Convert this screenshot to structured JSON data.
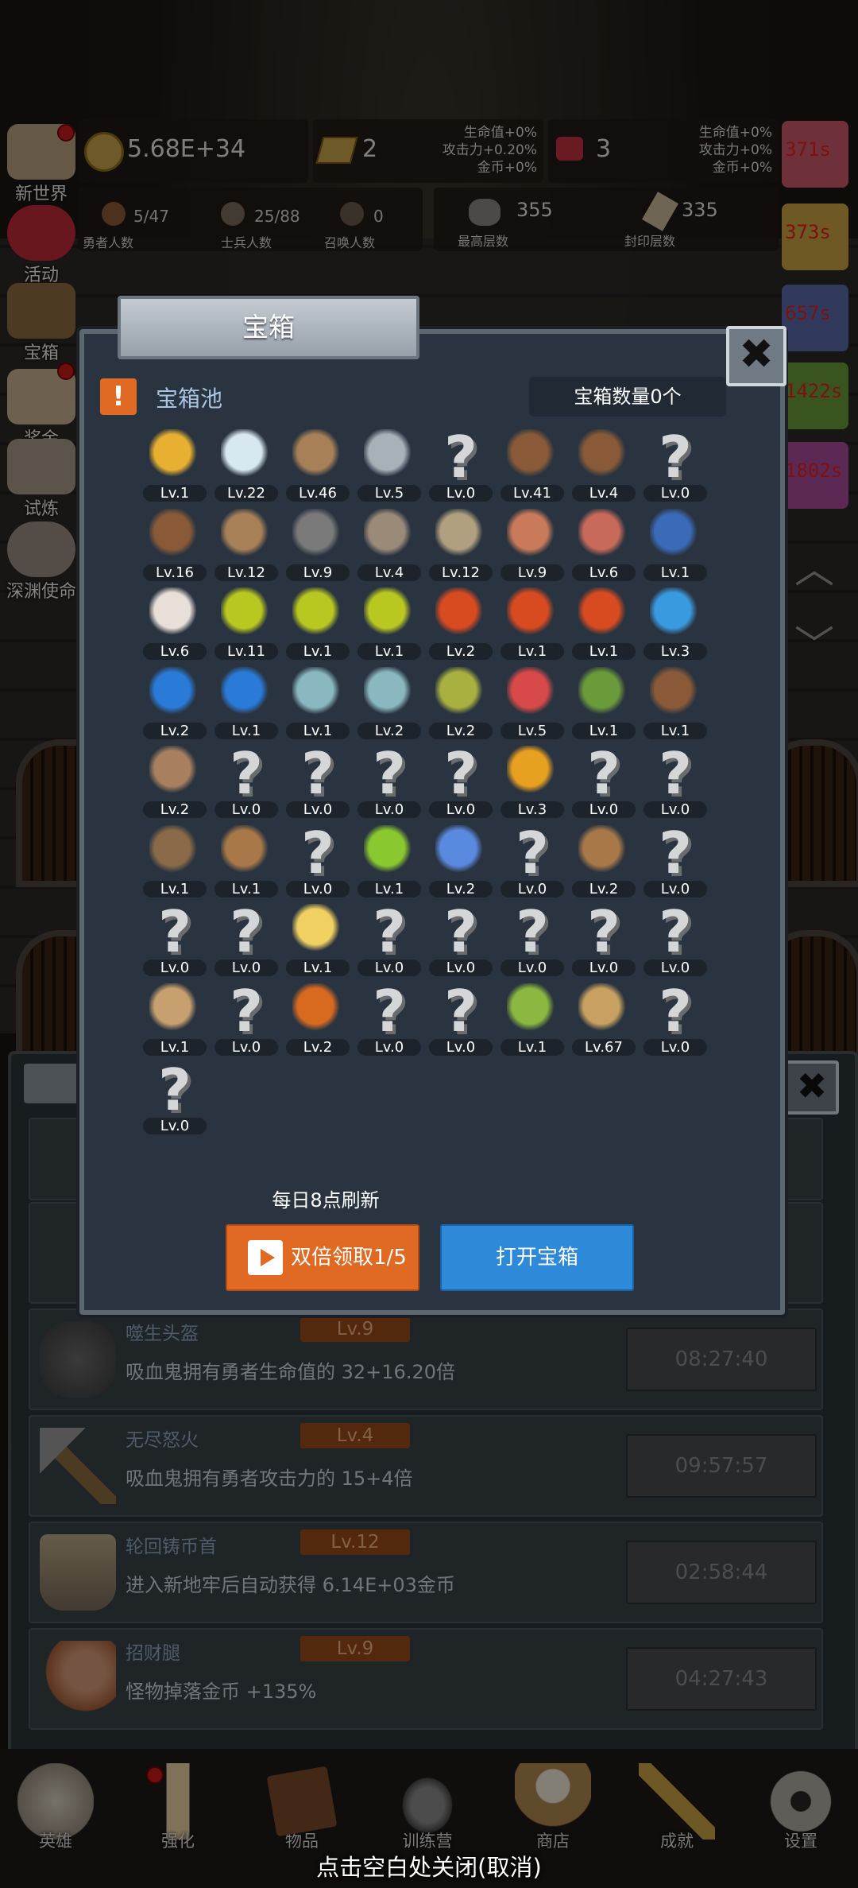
{
  "resources": {
    "gold": "5.68E+34",
    "gold_bar": "2",
    "gold_bar_stats": [
      "生命值+0%",
      "攻击力+0.20%",
      "金币+0%"
    ],
    "gem": "3",
    "gem_stats": [
      "生命值+0%",
      "攻击力+0%",
      "金币+0%"
    ],
    "heroes": "5/47",
    "heroes_label": "勇者人数",
    "soldiers": "25/88",
    "soldiers_label": "士兵人数",
    "summons": "0",
    "summons_label": "召唤人数",
    "max_floor": "355",
    "max_floor_label": "最高层数",
    "seal_floor": "335",
    "seal_floor_label": "封印层数"
  },
  "side_menu": [
    "新世界",
    "活动",
    "宝箱",
    "奖金",
    "试炼",
    "深渊使命"
  ],
  "side_timers": [
    "371s",
    "373s",
    "657s",
    "1422s",
    "1802s"
  ],
  "modal": {
    "title": "宝箱",
    "pool_label": "宝箱池",
    "count_label": "宝箱数量0个",
    "close": "✖",
    "refresh_text": "每日8点刷新",
    "double_button": "双倍领取1/5",
    "open_button": "打开宝箱"
  },
  "items": [
    {
      "icon": "crown-icon",
      "level": "Lv.1"
    },
    {
      "icon": "diamond-icon",
      "level": "Lv.22"
    },
    {
      "icon": "wooden-sword-icon",
      "level": "Lv.46"
    },
    {
      "icon": "steel-sword-icon",
      "level": "Lv.5"
    },
    {
      "icon": "unknown-icon",
      "level": "Lv.0"
    },
    {
      "icon": "leather-armor-icon",
      "level": "Lv.41"
    },
    {
      "icon": "backpack-icon",
      "level": "Lv.4"
    },
    {
      "icon": "unknown-icon",
      "level": "Lv.0"
    },
    {
      "icon": "leather-helmet-icon",
      "level": "Lv.16"
    },
    {
      "icon": "dagger-icon",
      "level": "Lv.12"
    },
    {
      "icon": "knight-helmet-icon",
      "level": "Lv.9"
    },
    {
      "icon": "hammer-icon",
      "level": "Lv.4"
    },
    {
      "icon": "great-helm-icon",
      "level": "Lv.12"
    },
    {
      "icon": "meat-icon",
      "level": "Lv.9"
    },
    {
      "icon": "steak-icon",
      "level": "Lv.6"
    },
    {
      "icon": "blue-sack-icon",
      "level": "Lv.1"
    },
    {
      "icon": "flour-bowl-icon",
      "level": "Lv.6"
    },
    {
      "icon": "yellow-potion-icon",
      "level": "Lv.11"
    },
    {
      "icon": "yellow-potion-icon",
      "level": "Lv.1"
    },
    {
      "icon": "yellow-potion-icon",
      "level": "Lv.1"
    },
    {
      "icon": "red-potion-icon",
      "level": "Lv.2"
    },
    {
      "icon": "red-potion-icon",
      "level": "Lv.1"
    },
    {
      "icon": "red-potion-icon",
      "level": "Lv.1"
    },
    {
      "icon": "blue-vial-icon",
      "level": "Lv.3"
    },
    {
      "icon": "blue-potion-icon",
      "level": "Lv.2"
    },
    {
      "icon": "blue-potion-icon",
      "level": "Lv.1"
    },
    {
      "icon": "cyan-vial-icon",
      "level": "Lv.1"
    },
    {
      "icon": "cyan-vial-icon",
      "level": "Lv.2"
    },
    {
      "icon": "green-flask-icon",
      "level": "Lv.2"
    },
    {
      "icon": "red-vial-icon",
      "level": "Lv.5"
    },
    {
      "icon": "winged-boots-icon",
      "level": "Lv.1"
    },
    {
      "icon": "boot-icon",
      "level": "Lv.1"
    },
    {
      "icon": "leather-shoe-icon",
      "level": "Lv.2"
    },
    {
      "icon": "unknown-icon",
      "level": "Lv.0"
    },
    {
      "icon": "unknown-icon",
      "level": "Lv.0"
    },
    {
      "icon": "unknown-icon",
      "level": "Lv.0"
    },
    {
      "icon": "unknown-icon",
      "level": "Lv.0"
    },
    {
      "icon": "torch-icon",
      "level": "Lv.3"
    },
    {
      "icon": "unknown-icon",
      "level": "Lv.0"
    },
    {
      "icon": "unknown-icon",
      "level": "Lv.0"
    },
    {
      "icon": "pickaxe-icon",
      "level": "Lv.1"
    },
    {
      "icon": "wooden-staff-icon",
      "level": "Lv.1"
    },
    {
      "icon": "unknown-icon",
      "level": "Lv.0"
    },
    {
      "icon": "lime-icon",
      "level": "Lv.1"
    },
    {
      "icon": "blue-wand-icon",
      "level": "Lv.2"
    },
    {
      "icon": "unknown-icon",
      "level": "Lv.0"
    },
    {
      "icon": "satchel-icon",
      "level": "Lv.2"
    },
    {
      "icon": "unknown-icon",
      "level": "Lv.0"
    },
    {
      "icon": "unknown-icon",
      "level": "Lv.0"
    },
    {
      "icon": "unknown-icon",
      "level": "Lv.0"
    },
    {
      "icon": "cheese-icon",
      "level": "Lv.1"
    },
    {
      "icon": "unknown-icon",
      "level": "Lv.0"
    },
    {
      "icon": "unknown-icon",
      "level": "Lv.0"
    },
    {
      "icon": "unknown-icon",
      "level": "Lv.0"
    },
    {
      "icon": "unknown-icon",
      "level": "Lv.0"
    },
    {
      "icon": "unknown-icon",
      "level": "Lv.0"
    },
    {
      "icon": "bow-icon",
      "level": "Lv.1"
    },
    {
      "icon": "unknown-icon",
      "level": "Lv.0"
    },
    {
      "icon": "flame-shield-icon",
      "level": "Lv.2"
    },
    {
      "icon": "unknown-icon",
      "level": "Lv.0"
    },
    {
      "icon": "unknown-icon",
      "level": "Lv.0"
    },
    {
      "icon": "green-wand-icon",
      "level": "Lv.1"
    },
    {
      "icon": "beer-mug-icon",
      "level": "Lv.67"
    },
    {
      "icon": "unknown-icon",
      "level": "Lv.0"
    },
    {
      "icon": "unknown-icon",
      "level": "Lv.0"
    }
  ],
  "background_rows": [
    {
      "name": "噬生头盔",
      "level": "Lv.9",
      "desc": "吸血鬼拥有勇者生命值的 32+16.20倍",
      "timer": "08:27:40",
      "icon": "knight-helmet-icon"
    },
    {
      "name": "无尽怒火",
      "level": "Lv.4",
      "desc": "吸血鬼拥有勇者攻击力的 15+4倍",
      "timer": "09:57:57",
      "icon": "hammer-icon"
    },
    {
      "name": "轮回铸币首",
      "level": "Lv.12",
      "desc": "进入新地牢后自动获得 6.14E+03金币",
      "timer": "02:58:44",
      "icon": "great-helm-icon"
    },
    {
      "name": "招财腿",
      "level": "Lv.9",
      "desc": "怪物掉落金币 +135%",
      "timer": "04:27:43",
      "icon": "meat-icon"
    }
  ],
  "bottom_nav": [
    "英雄",
    "强化",
    "物品",
    "训练营",
    "商店",
    "成就",
    "设置"
  ],
  "hint": "点击空白处关闭(取消)"
}
